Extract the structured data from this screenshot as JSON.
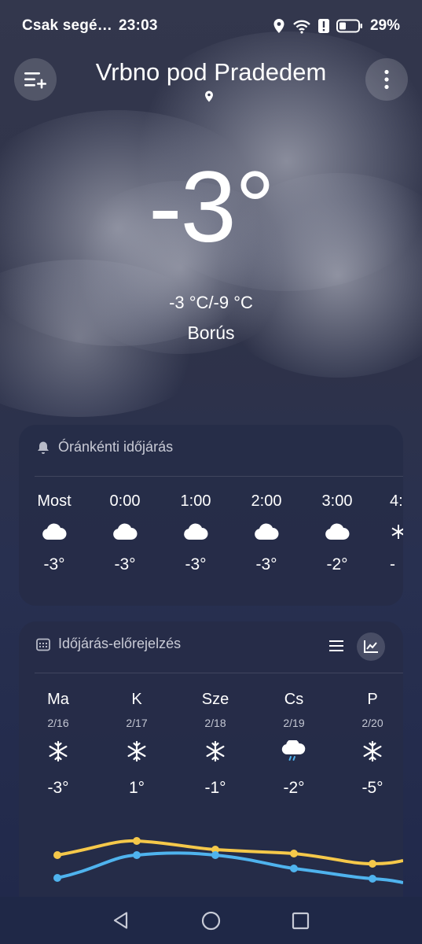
{
  "status_bar": {
    "carrier_text": "Csak segé…",
    "time": "23:03",
    "battery": "29%",
    "icons": [
      "location-icon",
      "wifi-icon",
      "alert-icon",
      "battery-icon"
    ]
  },
  "header": {
    "city": "Vrbno pod Pradedem",
    "menu_icon": "list-add-icon",
    "more_icon": "more-vertical-icon"
  },
  "current": {
    "temperature": "-3°",
    "range": "-3 °C/-9 °C",
    "condition": "Borús"
  },
  "hourly": {
    "title": "Óránkénti időjárás",
    "items": [
      {
        "time": "Most",
        "icon": "cloud-icon",
        "temp": "-3°"
      },
      {
        "time": "0:00",
        "icon": "cloud-icon",
        "temp": "-3°"
      },
      {
        "time": "1:00",
        "icon": "cloud-icon",
        "temp": "-3°"
      },
      {
        "time": "2:00",
        "icon": "cloud-icon",
        "temp": "-3°"
      },
      {
        "time": "3:00",
        "icon": "cloud-icon",
        "temp": "-2°"
      },
      {
        "time": "4:",
        "icon": "snow-icon",
        "temp": "-"
      }
    ]
  },
  "forecast": {
    "title": "Időjárás-előrejelzés",
    "view_icons": [
      "list-view-icon",
      "chart-view-icon"
    ],
    "days": [
      {
        "day": "Ma",
        "date": "2/16",
        "icon": "snowflake-icon",
        "temp": "-3°"
      },
      {
        "day": "K",
        "date": "2/17",
        "icon": "snowflake-icon",
        "temp": "1°"
      },
      {
        "day": "Sze",
        "date": "2/18",
        "icon": "snowflake-icon",
        "temp": "-1°"
      },
      {
        "day": "Cs",
        "date": "2/19",
        "icon": "rain-snow-cloud-icon",
        "temp": "-2°"
      },
      {
        "day": "P",
        "date": "2/20",
        "icon": "snowflake-icon",
        "temp": "-5°"
      }
    ],
    "colors": {
      "high_line": "#f5c84a",
      "low_line": "#4fb3ee"
    }
  },
  "nav_bar": {
    "icons": [
      "back-triangle-icon",
      "home-circle-icon",
      "recents-square-icon"
    ]
  }
}
